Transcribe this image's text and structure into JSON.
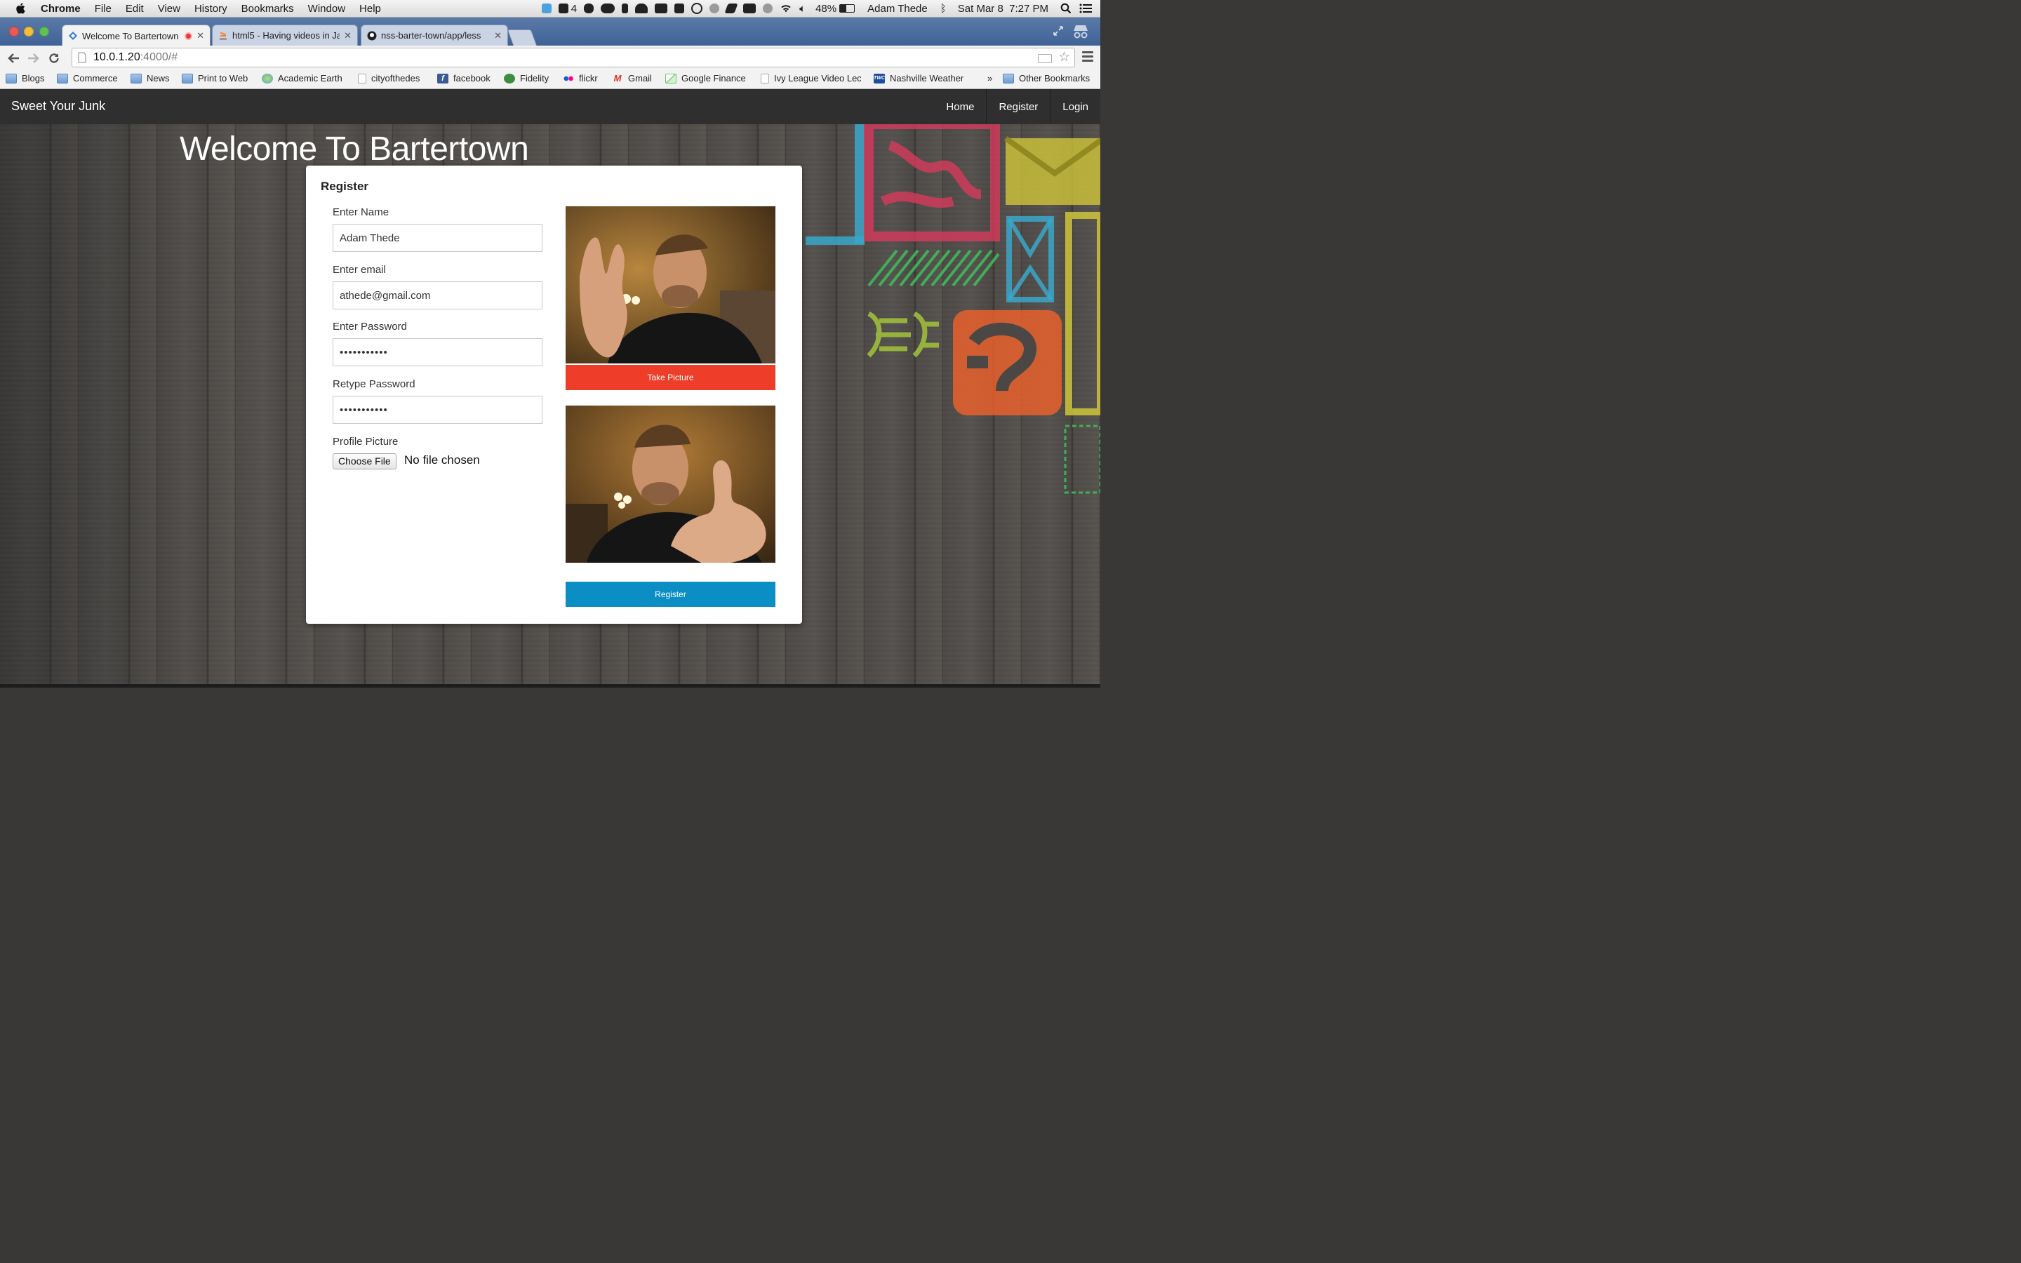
{
  "menubar": {
    "items": [
      "Chrome",
      "File",
      "Edit",
      "View",
      "History",
      "Bookmarks",
      "Window",
      "Help"
    ],
    "adobe_count": "4",
    "battery": "48%",
    "user": "Adam Thede",
    "datetime": "Sat Mar 8  7:27 PM"
  },
  "tabs": [
    {
      "label": "Welcome To Bartertown",
      "active": true,
      "icon": "diamond-favicon"
    },
    {
      "label": "html5 - Having videos in Ja",
      "active": false,
      "icon": "stackoverflow-favicon"
    },
    {
      "label": "nss-barter-town/app/less",
      "active": false,
      "icon": "github-favicon"
    }
  ],
  "address": {
    "host": "10.0.1.20",
    "path": ":4000/#"
  },
  "bookmarks": [
    {
      "label": "Blogs",
      "icon": "folder-icon"
    },
    {
      "label": "Commerce",
      "icon": "folder-icon"
    },
    {
      "label": "News",
      "icon": "folder-icon"
    },
    {
      "label": "Print to Web",
      "icon": "folder-icon"
    },
    {
      "label": "Academic Earth",
      "icon": "globe-icon"
    },
    {
      "label": "cityofthedes",
      "icon": "page-icon"
    },
    {
      "label": "facebook",
      "icon": "facebook-icon"
    },
    {
      "label": "Fidelity",
      "icon": "fidelity-icon"
    },
    {
      "label": "flickr",
      "icon": "flickr-icon"
    },
    {
      "label": "Gmail",
      "icon": "gmail-icon"
    },
    {
      "label": "Google Finance",
      "icon": "chart-icon"
    },
    {
      "label": "Ivy League Video Lec",
      "icon": "page-icon"
    },
    {
      "label": "Nashville Weather",
      "icon": "weather-channel-icon"
    },
    {
      "label": "»",
      "icon": "chevron"
    },
    {
      "label": "Other Bookmarks",
      "icon": "folder-icon"
    }
  ],
  "site": {
    "brand": "Sweet Your Junk",
    "nav": [
      "Home",
      "Register",
      "Login"
    ],
    "hero_title": "Welcome To Bartertown"
  },
  "form": {
    "title": "Register",
    "name_label": "Enter Name",
    "name_value": "Adam Thede",
    "email_label": "Enter email",
    "email_value": "athede@gmail.com",
    "password_label": "Enter Password",
    "password_value": "•••••••••••",
    "retype_label": "Retype Password",
    "retype_value": "•••••••••••",
    "picture_label": "Profile Picture",
    "choose_file": "Choose File",
    "no_file": "No file chosen",
    "take_picture": "Take Picture",
    "register_button": "Register"
  },
  "colors": {
    "take_button": "#ee3e29",
    "register_button": "#0b8ec4",
    "navbar": "#2f2f2f"
  }
}
